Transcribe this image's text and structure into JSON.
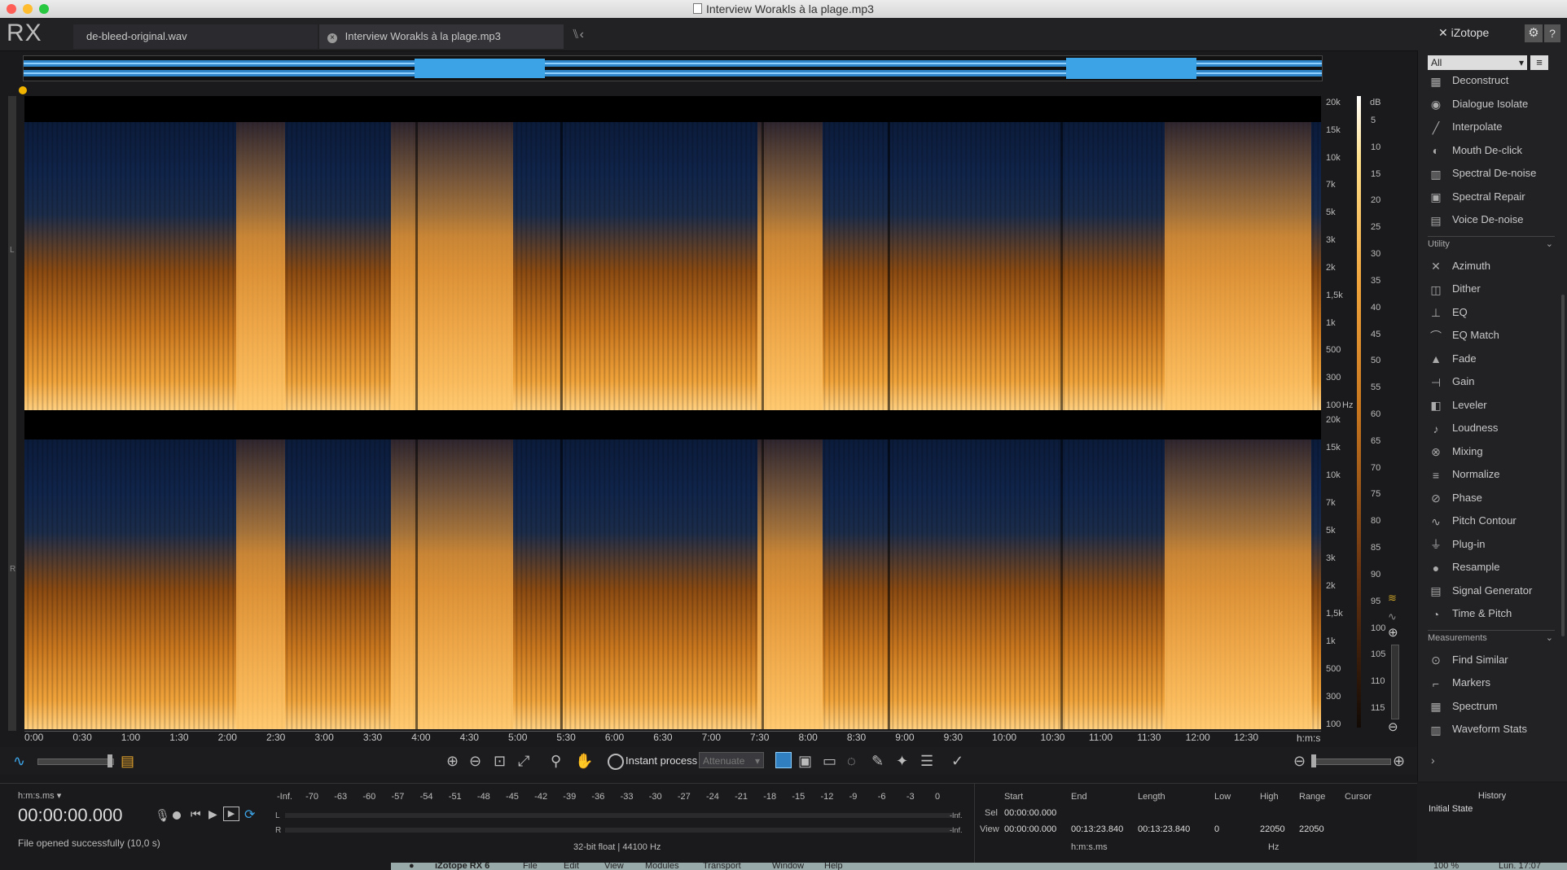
{
  "window": {
    "title": "Interview Worakls à la plage.mp3"
  },
  "app": {
    "logo": "RX",
    "brand": "iZotope"
  },
  "tabs": [
    {
      "label": "de-bleed-original.wav"
    },
    {
      "label": "Interview Worakls à la plage.mp3"
    }
  ],
  "freq_top": [
    "20k",
    "15k",
    "10k",
    "7k",
    "5k",
    "3k",
    "2k",
    "1,5k",
    "1k",
    "500",
    "300",
    "100"
  ],
  "freq_bottom": [
    "20k",
    "15k",
    "10k",
    "7k",
    "5k",
    "3k",
    "2k",
    "1,5k",
    "1k",
    "500",
    "300",
    "100"
  ],
  "hz_label": "Hz",
  "db_label": "dB",
  "db_scale": [
    "5",
    "10",
    "15",
    "20",
    "25",
    "30",
    "35",
    "40",
    "45",
    "50",
    "55",
    "60",
    "65",
    "70",
    "75",
    "80",
    "85",
    "90",
    "95",
    "100",
    "105",
    "110",
    "115"
  ],
  "channel_labels": {
    "left": "L",
    "right": "R"
  },
  "time_ticks": [
    "0:00",
    "0:30",
    "1:00",
    "1:30",
    "2:00",
    "2:30",
    "3:00",
    "3:30",
    "4:00",
    "4:30",
    "5:00",
    "5:30",
    "6:00",
    "6:30",
    "7:00",
    "7:30",
    "8:00",
    "8:30",
    "9:00",
    "9:30",
    "10:00",
    "10:30",
    "11:00",
    "11:30",
    "12:00",
    "12:30"
  ],
  "time_unit": "h:m:s",
  "toolbar": {
    "instant_process": "Instant process",
    "mode": "Attenuate"
  },
  "transport": {
    "format": "h:m:s.ms",
    "time": "00:00:00.000",
    "status": "File opened successfully (10,0 s)"
  },
  "meter": {
    "scale": [
      "-Inf.",
      "-70",
      "-63",
      "-60",
      "-57",
      "-54",
      "-51",
      "-48",
      "-45",
      "-42",
      "-39",
      "-36",
      "-33",
      "-30",
      "-27",
      "-24",
      "-21",
      "-18",
      "-15",
      "-12",
      "-9",
      "-6",
      "-3",
      "0"
    ],
    "left": "L",
    "right": "R",
    "left_peak": "-Inf.",
    "right_peak": "-Inf.",
    "format": "32-bit float | 44100 Hz"
  },
  "selection": {
    "headers": {
      "start": "Start",
      "end": "End",
      "length": "Length",
      "low": "Low",
      "high": "High",
      "range": "Range",
      "cursor": "Cursor"
    },
    "sel_label": "Sel",
    "view_label": "View",
    "sel_start": "00:00:00.000",
    "view_start": "00:00:00.000",
    "view_end": "00:13:23.840",
    "view_length": "00:13:23.840",
    "low": "0",
    "high": "22050",
    "range": "22050",
    "time_unit": "h:m:s.ms",
    "freq_unit": "Hz"
  },
  "modules": {
    "filter": "All",
    "repair": [
      "Deconstruct",
      "Dialogue Isolate",
      "Interpolate",
      "Mouth De-click",
      "Spectral De-noise",
      "Spectral Repair",
      "Voice De-noise"
    ],
    "utility_label": "Utility",
    "utility": [
      "Azimuth",
      "Dither",
      "EQ",
      "EQ Match",
      "Fade",
      "Gain",
      "Leveler",
      "Loudness",
      "Mixing",
      "Normalize",
      "Phase",
      "Pitch Contour",
      "Plug-in",
      "Resample",
      "Signal Generator",
      "Time & Pitch"
    ],
    "measurements_label": "Measurements",
    "measurements": [
      "Find Similar",
      "Markers",
      "Spectrum",
      "Waveform Stats"
    ]
  },
  "history": {
    "title": "History",
    "items": [
      "Initial State"
    ]
  },
  "dock": {
    "app": "iZotope RX 6",
    "menus": [
      "File",
      "Edit",
      "View",
      "Modules",
      "Transport",
      "Window",
      "Help"
    ],
    "battery": "100 %",
    "clock": "Lun. 17:07"
  },
  "colors": {
    "accent": "#2f7fc1",
    "waveform": "#3ca4e6",
    "spec_low": "#0b1b3a",
    "spec_high": "#ffd080"
  }
}
